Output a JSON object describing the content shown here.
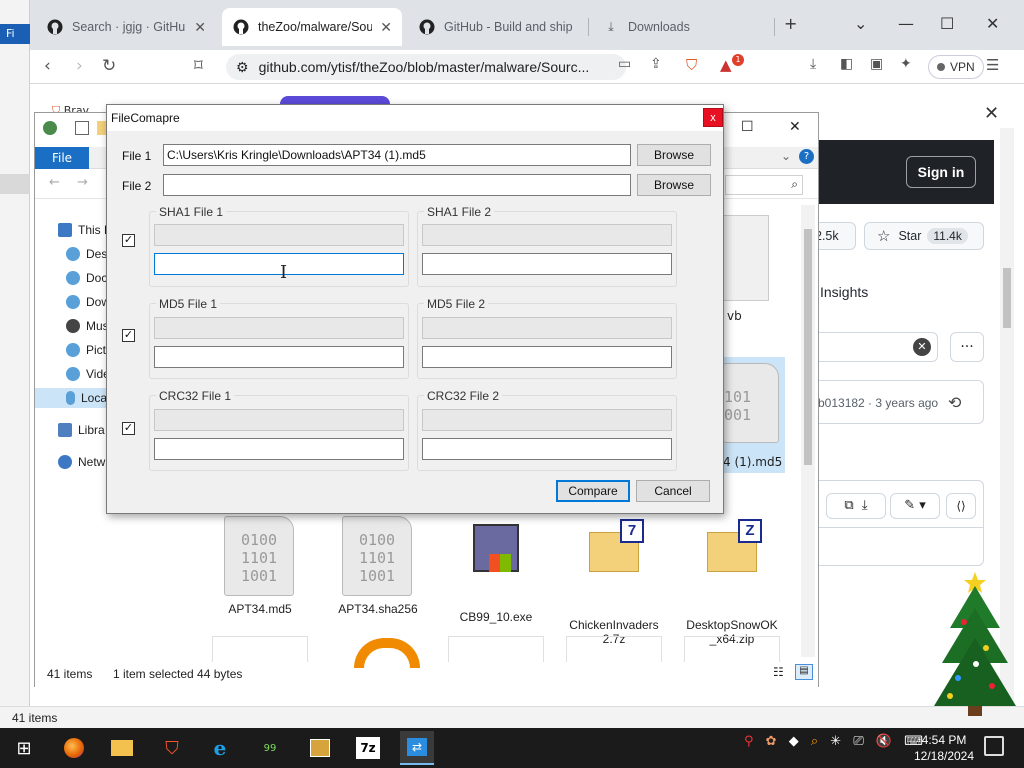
{
  "desktop": {
    "left_label": "Fi",
    "bottom_status": "41 items"
  },
  "browser": {
    "tabs": [
      {
        "label": "Search · jgjg · GitHub",
        "close": "✕"
      },
      {
        "label": "theZoo/malware/Sou",
        "close": "✕"
      },
      {
        "label": "GitHub - Build and ship s",
        "close": ""
      },
      {
        "label": "Downloads",
        "close": ""
      }
    ],
    "new_tab": "+",
    "window_controls": {
      "dropdown": "⌄",
      "minimize": "—",
      "maximize": "☐",
      "close": "✕"
    },
    "url": "github.com/ytisf/theZoo/blob/master/malware/Sourc...",
    "vpn_label": "VPN",
    "brave_badge": "1",
    "side_partial": "Brav"
  },
  "github": {
    "sign_in": "Sign in",
    "close": "✕",
    "fork_count": "2.5k",
    "star_label": "Star",
    "star_count": "11.4k",
    "insights": "Insights",
    "commit_info": "b013182 · 3 years ago",
    "more": "···"
  },
  "explorer": {
    "file_tab": "File",
    "nav_items": [
      {
        "label": "This P",
        "color": "#3c78c3"
      },
      {
        "label": "Desk",
        "color": "#5aa0d8"
      },
      {
        "label": "Docu",
        "color": "#5aa0d8"
      },
      {
        "label": "Dow",
        "color": "#5aa0d8"
      },
      {
        "label": "Mus",
        "color": "#444444"
      },
      {
        "label": "Pict",
        "color": "#5aa0d8"
      },
      {
        "label": "Vide",
        "color": "#5aa0d8"
      },
      {
        "label": "Loca",
        "color": "#5aa0d8"
      },
      {
        "label": "Libra",
        "color": "#4f7fbf"
      },
      {
        "label": "Netw",
        "color": "#3c78c3"
      }
    ],
    "files": [
      {
        "name": "APT34.md5",
        "kind": "doc",
        "glyph": "0100\n1101\n1001"
      },
      {
        "name": "APT34.sha256",
        "kind": "doc",
        "glyph": "0100\n1101\n1001"
      },
      {
        "name": "CB99_10.exe",
        "kind": "exe",
        "glyph": ""
      },
      {
        "name": "ChickenInvaders 2.7z",
        "kind": "zip",
        "glyph": "7"
      },
      {
        "name": "DesktopSnowOK _x64.zip",
        "kind": "zip",
        "glyph": "Z"
      }
    ],
    "partial_items": {
      "vb": "vb",
      "selected_file": "4 (1).md5",
      "selected_glyph": "101\n001"
    },
    "status_count": "41 items",
    "status_selected": "1 item selected  44 bytes",
    "window_controls": {
      "maximize": "☐",
      "close": "✕"
    }
  },
  "dialog": {
    "title": "FileComapre",
    "close": "x",
    "file1_label": "File 1",
    "file1_value": "C:\\Users\\Kris Kringle\\Downloads\\APT34 (1).md5",
    "file2_label": "File 2",
    "file2_value": "",
    "browse_label": "Browse",
    "check_mark": "✓",
    "sections": [
      {
        "left": "SHA1 File 1",
        "right": "SHA1 File 2",
        "checked": true
      },
      {
        "left": "MD5 File 1",
        "right": "MD5 File 2",
        "checked": true
      },
      {
        "left": "CRC32 File 1",
        "right": "CRC32 File 2",
        "checked": true
      }
    ],
    "compare_label": "Compare",
    "cancel_label": "Cancel"
  },
  "taskbar": {
    "start": "⊞",
    "clock_time": "4:54 PM",
    "clock_date": "12/18/2024",
    "apps": [
      "firefox",
      "file-explorer",
      "brave",
      "internet-explorer",
      "game",
      "media-player",
      "7zip",
      "file-compare"
    ],
    "app_labels": {
      "game": "99",
      "7zip": "7z"
    }
  },
  "colors": {
    "accent": "#0078d7",
    "close_red": "#e81123",
    "taskbar": "#1b1b1b",
    "github_dark": "#1f2328"
  }
}
